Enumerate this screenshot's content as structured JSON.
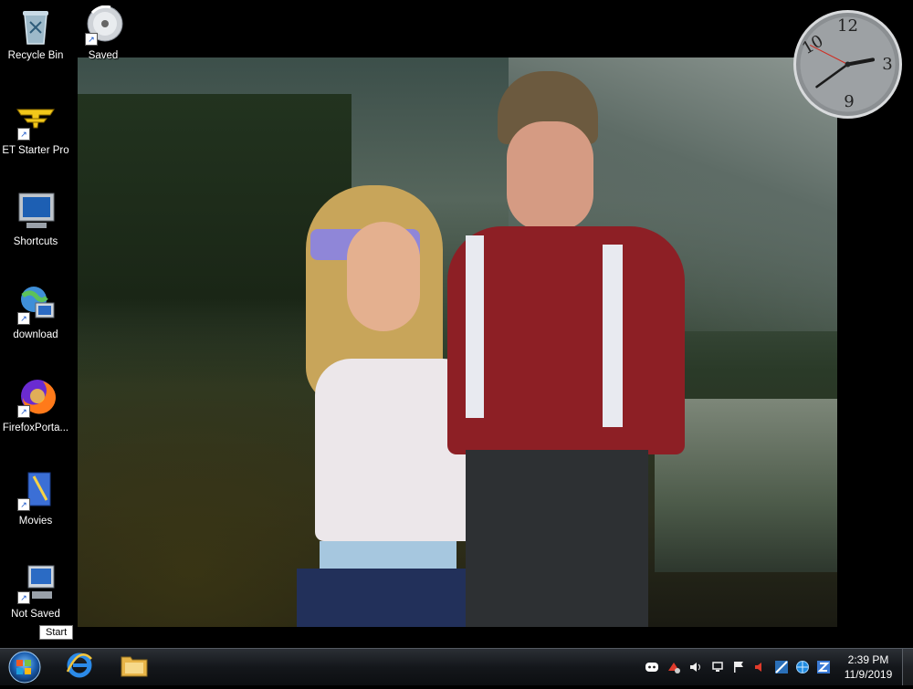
{
  "desktop": {
    "icons": [
      {
        "label": "Recycle Bin",
        "icon": "recycle-bin-icon"
      },
      {
        "label": "Saved",
        "icon": "disc-icon"
      },
      {
        "label": "ET Starter Pro",
        "icon": "et-logo-icon"
      },
      {
        "label": "Shortcuts",
        "icon": "monitor-icon"
      },
      {
        "label": "download",
        "icon": "network-globe-icon"
      },
      {
        "label": "FirefoxPorta...",
        "icon": "firefox-icon"
      },
      {
        "label": "Movies",
        "icon": "document-icon"
      },
      {
        "label": "Not Saved",
        "icon": "computer-icon"
      }
    ]
  },
  "clock_gadget": {
    "numerals": [
      "12",
      "3",
      "9",
      "10"
    ],
    "hour": 2,
    "minute": 39
  },
  "tooltip": {
    "text": "Start"
  },
  "taskbar": {
    "pinned": [
      {
        "name": "internet-explorer",
        "icon": "ie-icon"
      },
      {
        "name": "file-explorer",
        "icon": "folder-icon"
      }
    ],
    "tray_icons": [
      "discord-icon",
      "app-icon",
      "volume-icon",
      "network-icon",
      "flag-icon",
      "speaker-icon",
      "display-icon",
      "globe-icon",
      "z-icon"
    ],
    "time": "2:39 PM",
    "date": "11/9/2019"
  },
  "colors": {
    "taskbar": "#14171b",
    "accent_blue": "#1a56c9",
    "flag_red": "#e03b2b"
  }
}
